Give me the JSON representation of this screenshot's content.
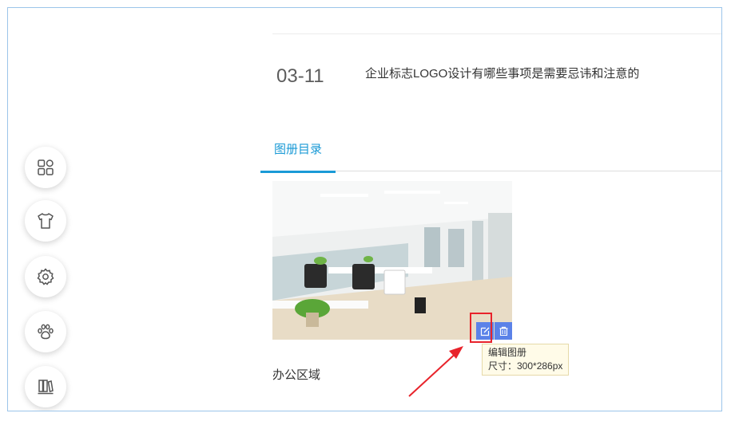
{
  "news": {
    "date": "03-11",
    "title": "企业标志LOGO设计有哪些事项是需要忌讳和注意的"
  },
  "tabs": {
    "active_label": "图册目录"
  },
  "album": {
    "name": "办公区域",
    "tooltip_title": "编辑图册",
    "tooltip_size": "尺寸：300*286px"
  },
  "icons": {
    "edit": "edit-icon",
    "delete": "trash-icon",
    "sidebar": [
      "grid-icon",
      "tshirt-icon",
      "gear-icon",
      "paw-icon",
      "books-icon"
    ]
  },
  "colors": {
    "accent": "#1a9ad6",
    "action_button": "#5b82e8",
    "annotation": "#e8232b"
  }
}
